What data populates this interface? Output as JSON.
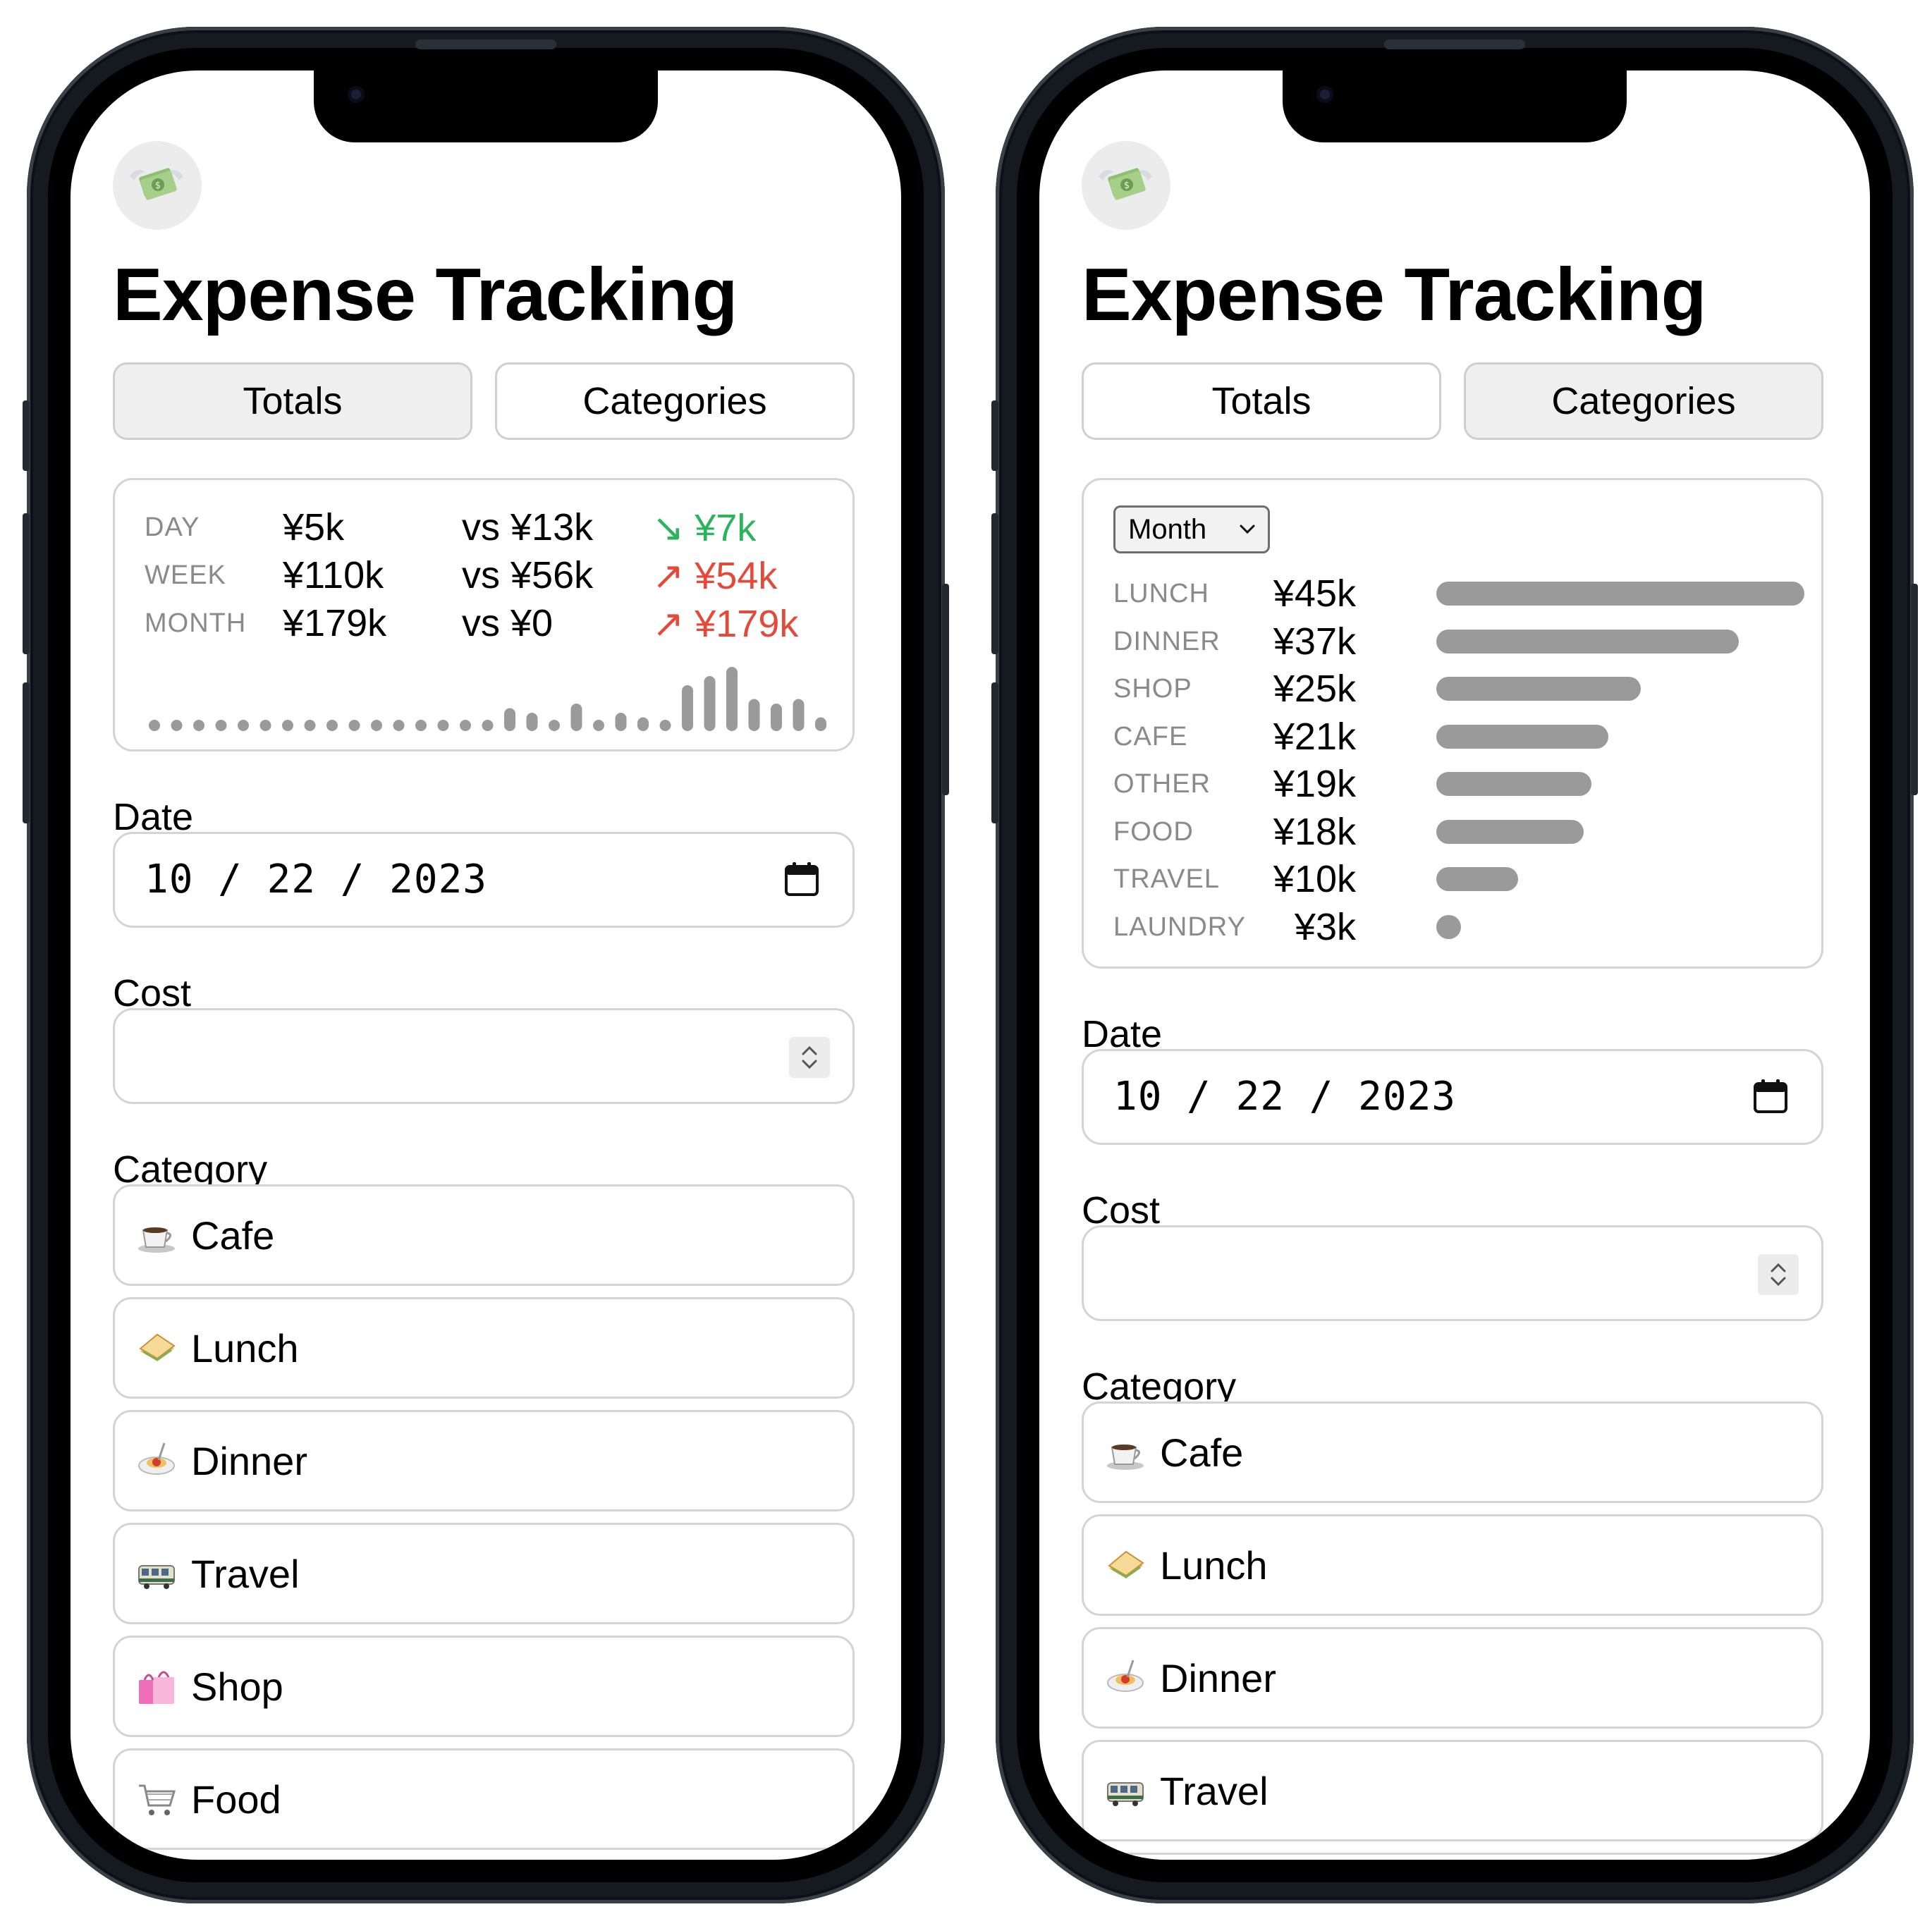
{
  "colors": {
    "delta_down": "#2bb55a",
    "delta_up": "#e5493a",
    "bar": "#9a9a9a"
  },
  "app_icon": "money-with-wings-icon",
  "left": {
    "title": "Expense Tracking",
    "tabs": [
      {
        "label": "Totals",
        "active": true
      },
      {
        "label": "Categories",
        "active": false
      }
    ],
    "stats": [
      {
        "period": "DAY",
        "amount": "¥5k",
        "compare": "vs ¥13k",
        "direction": "down",
        "arrow": "↘",
        "delta": "¥7k"
      },
      {
        "period": "WEEK",
        "amount": "¥110k",
        "compare": "vs ¥56k",
        "direction": "up",
        "arrow": "↗",
        "delta": "¥54k"
      },
      {
        "period": "MONTH",
        "amount": "¥179k",
        "compare": "vs ¥0",
        "direction": "up",
        "arrow": "↗",
        "delta": "¥179k"
      }
    ],
    "chart_data": {
      "type": "bar",
      "values": [
        0,
        0,
        0,
        0,
        0,
        0,
        0,
        0,
        0,
        0,
        0,
        0,
        0,
        0,
        0,
        0,
        2.5,
        2,
        1,
        3,
        1,
        2,
        1.5,
        1,
        5,
        6,
        7,
        3.5,
        3,
        3.5,
        1.5
      ]
    },
    "date_label": "Date",
    "date_value": "10 / 22 / 2023",
    "cost_label": "Cost",
    "cost_value": "",
    "category_label": "Category",
    "categories": [
      {
        "label": "Cafe",
        "icon": "coffee-icon"
      },
      {
        "label": "Lunch",
        "icon": "sandwich-icon"
      },
      {
        "label": "Dinner",
        "icon": "spaghetti-icon"
      },
      {
        "label": "Travel",
        "icon": "tram-icon"
      },
      {
        "label": "Shop",
        "icon": "shopping-bags-icon"
      },
      {
        "label": "Food",
        "icon": "shopping-cart-icon"
      }
    ]
  },
  "right": {
    "title": "Expense Tracking",
    "tabs": [
      {
        "label": "Totals",
        "active": false
      },
      {
        "label": "Categories",
        "active": true
      }
    ],
    "period_select": "Month",
    "chart_data": {
      "type": "bar",
      "orientation": "horizontal",
      "categories": [
        "LUNCH",
        "DINNER",
        "SHOP",
        "CAFE",
        "OTHER",
        "FOOD",
        "TRAVEL",
        "LAUNDRY"
      ],
      "labels": [
        "¥45k",
        "¥37k",
        "¥25k",
        "¥21k",
        "¥19k",
        "¥18k",
        "¥10k",
        "¥3k"
      ],
      "values": [
        45,
        37,
        25,
        21,
        19,
        18,
        10,
        3
      ]
    },
    "date_label": "Date",
    "date_value": "10 / 22 / 2023",
    "cost_label": "Cost",
    "cost_value": "",
    "category_label": "Category",
    "categories": [
      {
        "label": "Cafe",
        "icon": "coffee-icon"
      },
      {
        "label": "Lunch",
        "icon": "sandwich-icon"
      },
      {
        "label": "Dinner",
        "icon": "spaghetti-icon"
      },
      {
        "label": "Travel",
        "icon": "tram-icon"
      },
      {
        "label": "",
        "icon": "shopping-bags-icon"
      }
    ]
  }
}
